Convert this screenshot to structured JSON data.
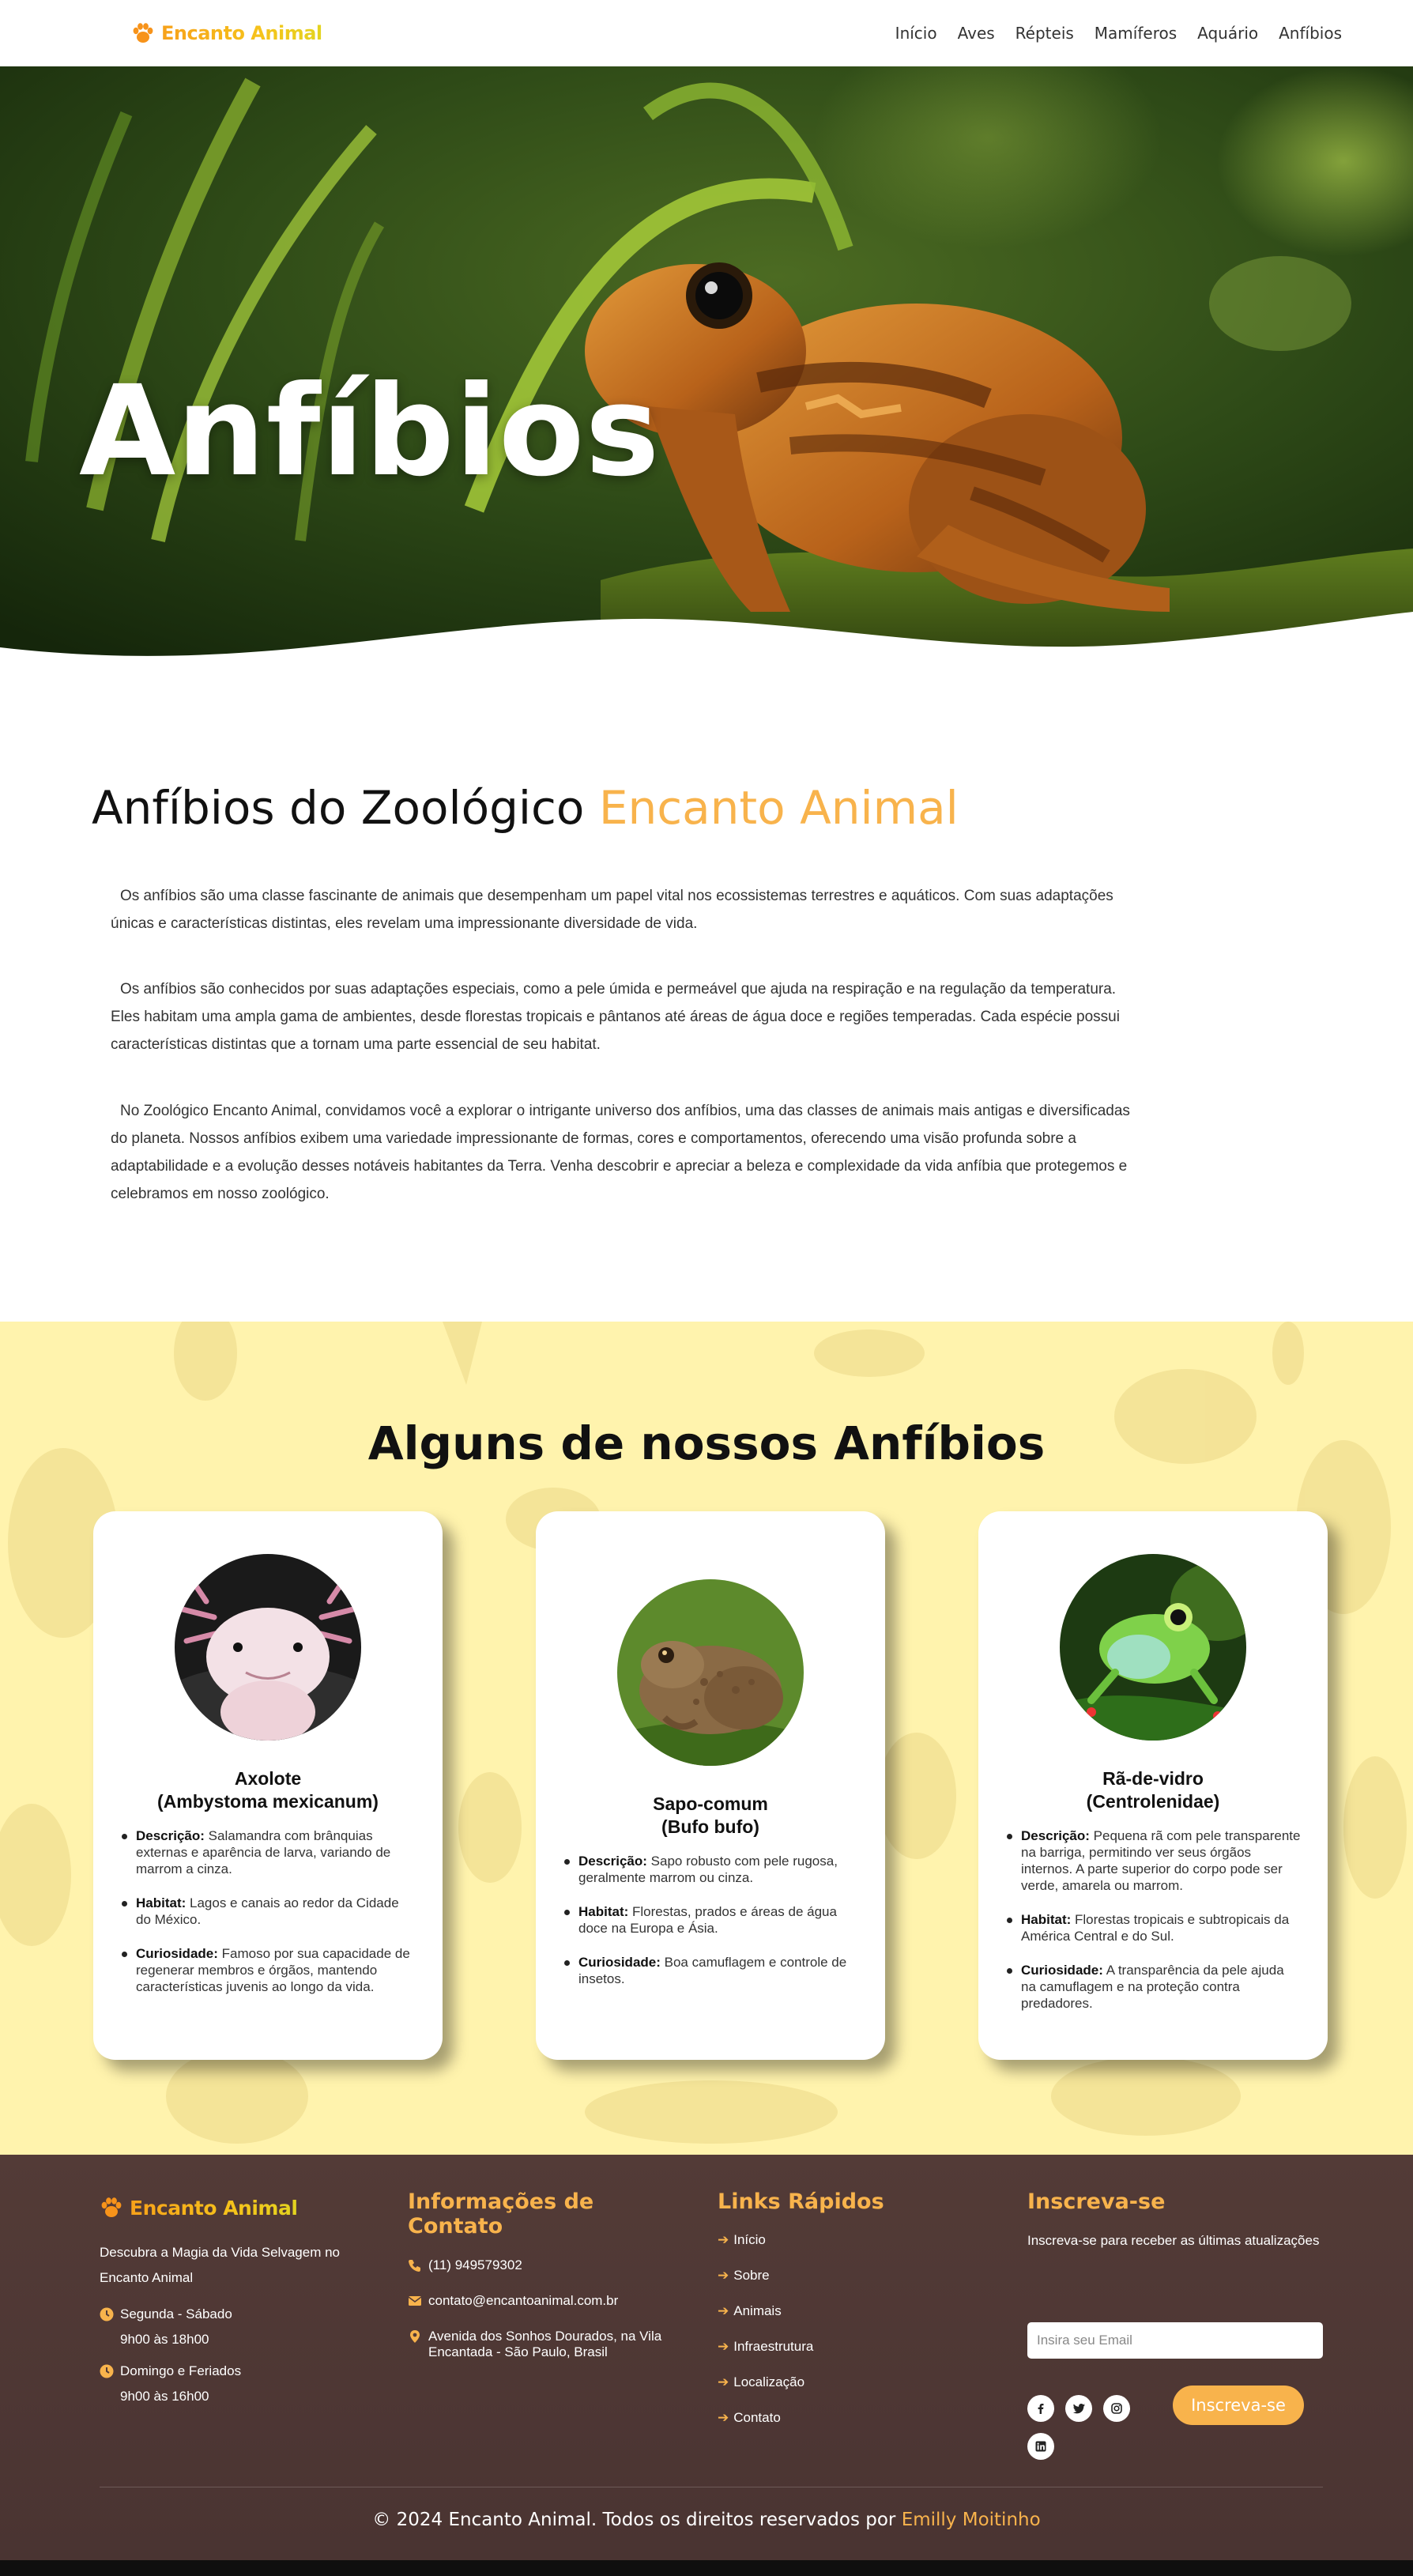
{
  "brand": {
    "name": "Encanto Animal"
  },
  "nav": {
    "items": [
      "Início",
      "Aves",
      "Répteis",
      "Mamíferos",
      "Aquário",
      "Anfíbios"
    ]
  },
  "hero": {
    "title": "Anfíbios"
  },
  "intro": {
    "heading": "Anfíbios do Zoológico",
    "heading_accent": "Encanto Animal",
    "paragraphs": [
      "Os anfíbios são uma classe fascinante de animais que desempenham um papel vital nos ecossistemas terrestres e aquáticos. Com suas adaptações únicas e características distintas, eles revelam uma impressionante diversidade de vida.",
      "Os anfíbios são conhecidos por suas adaptações especiais, como a pele úmida e permeável que ajuda na respiração e na regulação da temperatura. Eles habitam uma ampla gama de ambientes, desde florestas tropicais e pântanos até áreas de água doce e regiões temperadas. Cada espécie possui características distintas que a tornam uma parte essencial de seu habitat.",
      "No Zoológico Encanto Animal, convidamos você a explorar o intrigante universo dos anfíbios, uma das classes de animais mais antigas e diversificadas do planeta. Nossos anfíbios exibem uma variedade impressionante de formas, cores e comportamentos, oferecendo uma visão profunda sobre a adaptabilidade e a evolução desses notáveis habitantes da Terra. Venha descobrir e apreciar a beleza e complexidade da vida anfíbia que protegemos e celebramos em nosso zoológico."
    ]
  },
  "animals": {
    "title": "Alguns de nossos Anfíbios",
    "labels": {
      "description": "Descrição:",
      "habitat": "Habitat:",
      "curiosity": "Curiosidade:"
    },
    "cards": [
      {
        "name": "Axolote",
        "scientific": "(Ambystoma mexicanum)",
        "description": "Salamandra com brânquias externas e aparência de larva, variando de marrom a cinza.",
        "habitat": "Lagos e canais ao redor da Cidade do México.",
        "curiosity": "Famoso por sua capacidade de regenerar membros e órgãos, mantendo características juvenis ao longo da vida."
      },
      {
        "name": "Sapo-comum",
        "scientific": "(Bufo bufo)",
        "description": "Sapo robusto com pele rugosa, geralmente marrom ou cinza.",
        "habitat": "Florestas, prados e áreas de água doce na Europa e Ásia.",
        "curiosity": "Boa camuflagem e controle de insetos."
      },
      {
        "name": "Rã-de-vidro",
        "scientific": "(Centrolenidae)",
        "description": "Pequena rã com pele transparente na barriga, permitindo ver seus órgãos internos. A parte superior do corpo pode ser verde, amarela ou marrom.",
        "habitat": "Florestas tropicais e subtropicais da América Central e do Sul.",
        "curiosity": "A transparência da pele ajuda na camuflagem e na proteção contra predadores."
      }
    ]
  },
  "footer": {
    "tagline": "Descubra a Magia da Vida Selvagem no Encanto Animal",
    "hours": [
      {
        "days": "Segunda - Sábado",
        "time": "9h00 às 18h00"
      },
      {
        "days": "Domingo e Feriados",
        "time": "9h00 às 16h00"
      }
    ],
    "contact": {
      "heading": "Informações de Contato",
      "phone": "(11) 949579302",
      "email": "contato@encantoanimal.com.br",
      "address": "Avenida dos Sonhos Dourados, na Vila Encantada - São Paulo, Brasil"
    },
    "links": {
      "heading": "Links Rápidos",
      "items": [
        "Início",
        "Sobre",
        "Animais",
        "Infraestrutura",
        "Localização",
        "Contato"
      ]
    },
    "subscribe": {
      "heading": "Inscreva-se",
      "text": "Inscreva-se para receber as últimas atualizações",
      "placeholder": "Insira seu Email",
      "button": "Inscreva-se"
    },
    "social_icons": [
      "facebook-icon",
      "twitter-icon",
      "instagram-icon",
      "linkedin-icon"
    ],
    "copyright": "© 2024 Encanto Animal. Todos os direitos reservados por",
    "author": "Emilly Moitinho"
  },
  "colors": {
    "accent": "#f8b34c",
    "section_bg": "#fff3ad",
    "footer_bg": "#533b37"
  }
}
